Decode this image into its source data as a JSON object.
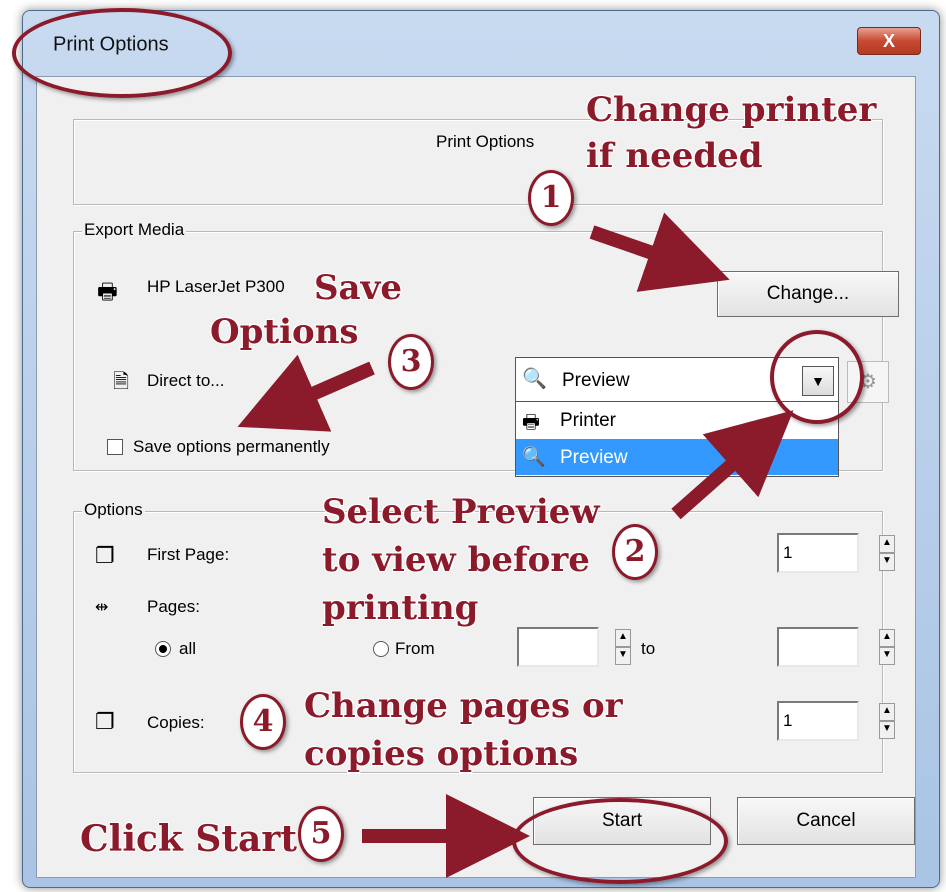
{
  "window": {
    "title": "Print Options",
    "close_label": "X"
  },
  "header_box": {
    "caption": "Print Options"
  },
  "export_media": {
    "legend": "Export Media",
    "printer_name": "HP LaserJet P300",
    "change_button": "Change...",
    "direct_to_label": "Direct to...",
    "direct_to_selected": "Preview",
    "dropdown_options": [
      "Printer",
      "Preview"
    ],
    "save_permanently_label": "Save options permanently"
  },
  "options": {
    "legend": "Options",
    "first_page_label": "First Page:",
    "first_page_value": "1",
    "pages_label": "Pages:",
    "all_label": "all",
    "from_label": "From",
    "from_value": "",
    "to_label": "to",
    "to_value": "",
    "copies_label": "Copies:",
    "copies_value": "1"
  },
  "buttons": {
    "start": "Start",
    "cancel": "Cancel"
  },
  "annotations": {
    "a1": "Change printer",
    "a1b": "if  needed",
    "a3a": "Save",
    "a3b": "Options",
    "a2a": "Select Preview",
    "a2b": "to view before",
    "a2c": "printing",
    "a4a": "Change pages or",
    "a4b": "copies options",
    "a5": "Click Start",
    "n1": "1",
    "n2": "2",
    "n3": "3",
    "n4": "4",
    "n5": "5"
  },
  "colors": {
    "annotation": "#8b1a2b",
    "selection": "#3399ff"
  }
}
